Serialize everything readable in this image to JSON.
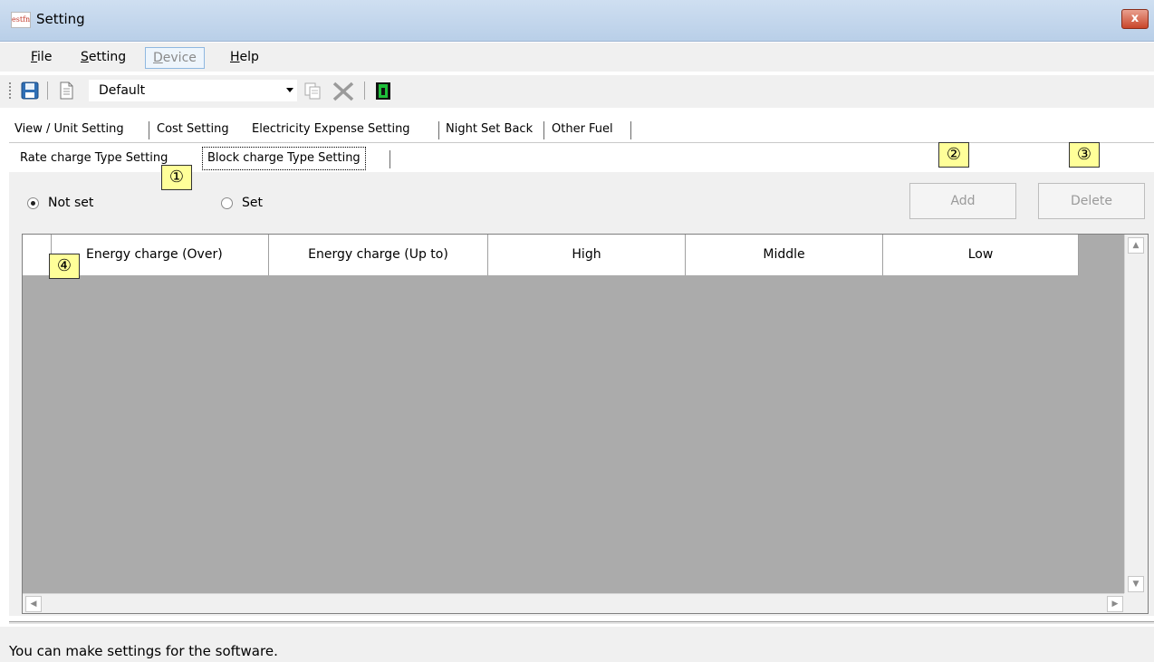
{
  "window": {
    "title": "Setting",
    "icon_label": "estfn",
    "close_label": "x"
  },
  "menu": {
    "items": [
      {
        "label": "File",
        "mnemonic": "F",
        "rest": "ile"
      },
      {
        "label": "Setting",
        "mnemonic": "S",
        "rest": "etting"
      },
      {
        "label": "Device",
        "mnemonic": "D",
        "rest": "evice"
      },
      {
        "label": "Help",
        "mnemonic": "H",
        "rest": "elp"
      }
    ]
  },
  "toolbar": {
    "profile_value": "Default"
  },
  "tabs": {
    "main": [
      "View / Unit Setting",
      "Cost Setting",
      "Electricity Expense Setting",
      "Night Set Back",
      "Other Fuel"
    ],
    "sub": [
      "Rate charge Type Setting",
      "Block charge Type Setting"
    ]
  },
  "options": {
    "not_set": "Not set",
    "set": "Set",
    "selected": "Not set"
  },
  "buttons": {
    "add": "Add",
    "delete": "Delete"
  },
  "table": {
    "columns": [
      "Energy charge (Over)",
      "Energy charge (Up to)",
      "High",
      "Middle",
      "Low"
    ],
    "rows": []
  },
  "badges": [
    "①",
    "②",
    "③",
    "④"
  ],
  "status": {
    "text": "You can make settings for the software."
  },
  "colors": {
    "titlebar": "#c4d8ee",
    "grid_background": "#ababab",
    "badge": "#ffff99",
    "close": "#c9462b"
  }
}
